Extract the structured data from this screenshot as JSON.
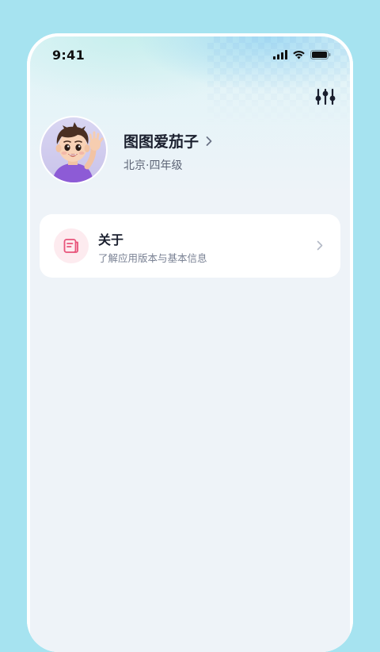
{
  "status_bar": {
    "time": "9:41",
    "icons": [
      "signal-icon",
      "wifi-icon",
      "battery-icon"
    ]
  },
  "header": {
    "settings_icon": "sliders-icon"
  },
  "profile": {
    "avatar_icon": "avatar-boy-waving",
    "name": "图图爱茄子",
    "location": "北京·四年级"
  },
  "menu": {
    "items": [
      {
        "icon": "book-icon",
        "title": "关于",
        "subtitle": "了解应用版本与基本信息"
      }
    ]
  },
  "colors": {
    "page_bg": "#a6e3f0",
    "screen_bg": "#eef3f8",
    "card_bg": "#ffffff",
    "icon_accent": "#e8537a",
    "icon_bg": "#fdebef",
    "text_primary": "#1a1f2e",
    "text_secondary": "#5b6375"
  }
}
